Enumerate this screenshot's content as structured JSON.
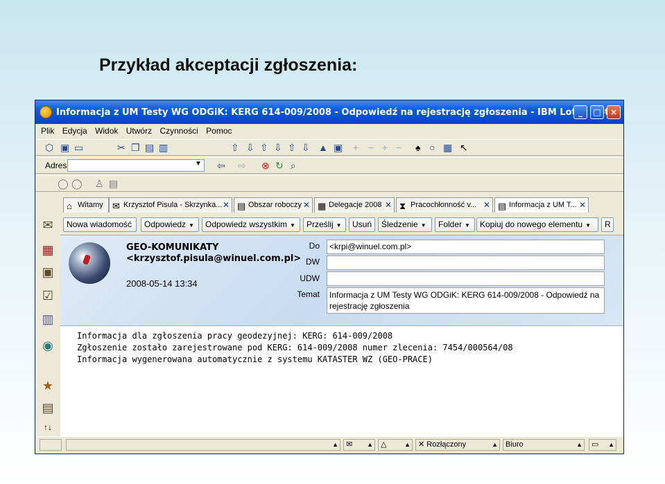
{
  "slide": {
    "title": "Przykład akceptacji zgłoszenia:"
  },
  "window": {
    "title": "Informacja z UM Testy WG ODGiK: KERG 614-009/2008 - Odpowiedź na rejestrację zgłoszenia - IBM Lotus Notes",
    "min_glyph": "_",
    "max_glyph": "□",
    "close_glyph": "×"
  },
  "menu": [
    "Plik",
    "Edycja",
    "Widok",
    "Utwórz",
    "Czynności",
    "Pomoc"
  ],
  "address": {
    "label": "Adres",
    "value": ""
  },
  "tabs": [
    {
      "label": "Witamy",
      "icon": "home-icon",
      "closable": false
    },
    {
      "label": "Krzysztof Pisula - Skrzynka...",
      "icon": "mailbox-icon",
      "closable": true
    },
    {
      "label": "Obszar roboczy",
      "icon": "workspace-icon",
      "closable": true
    },
    {
      "label": "Delegacje 2008",
      "icon": "database-icon",
      "closable": true
    },
    {
      "label": "Pracochłonność v...",
      "icon": "hourglass-icon",
      "closable": true
    },
    {
      "label": "Informacja z UM T...",
      "icon": "document-icon",
      "closable": true,
      "active": true
    }
  ],
  "actions": [
    "Nowa wiadomość",
    "Odpowiedz",
    "Odpowiedz wszystkim",
    "Prześlij",
    "Usuń",
    "Śledzenie",
    "Folder",
    "Kopiuj do nowego elementu",
    "R"
  ],
  "message": {
    "sender_name": "GEO-KOMUNIKATY",
    "sender_email": "<krzysztof.pisula@winuel.com.pl>",
    "date": "2008-05-14 13:34",
    "fields": {
      "do_label": "Do",
      "do_value": "<krpi@winuel.com.pl>",
      "dw_label": "DW",
      "dw_value": "",
      "udw_label": "UDW",
      "udw_value": "",
      "temat_label": "Temat",
      "temat_value": "Informacja z UM Testy WG ODGiK: KERG 614-009/2008 - Odpowiedź na rejestrację zgłoszenia"
    },
    "body": [
      "Informacja dla zgłoszenia pracy geodezyjnej: KERG: 614-009/2008",
      "Zgłoszenie zostało zarejestrowane pod KERG: 614-009/2008 numer zlecenia: 7454/000564/08",
      "",
      "Informacja wygenerowana automatycznie z systemu KATASTER WZ (GEO-PRACE)"
    ]
  },
  "status": {
    "connection": "Rozłączony",
    "location": "Biuro"
  }
}
